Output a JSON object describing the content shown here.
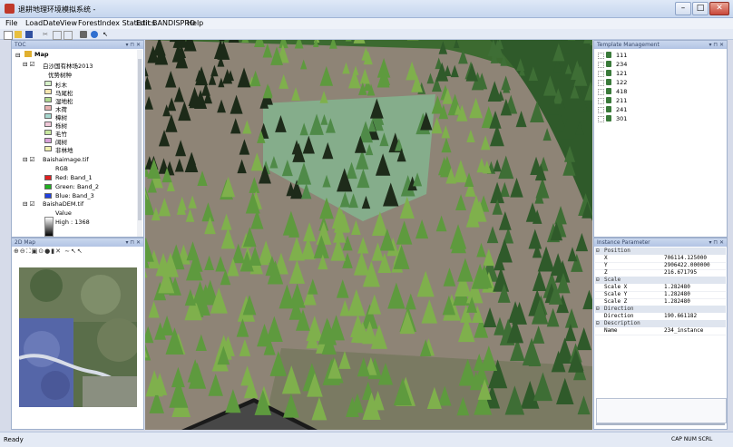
{
  "window": {
    "title": "退耕地理环境模拟系统 -",
    "minimize": "–",
    "maximize": "□",
    "close": "✕"
  },
  "menu": [
    "File",
    "LoadDate",
    "View",
    "Forest",
    "Index Statistics",
    "Edit",
    "BANDISPRO",
    "Help"
  ],
  "toc": {
    "panel_title": "TOC",
    "root_label": "Map",
    "layer1_label": "白沙国有林场2013",
    "layer1_field": "优势树种",
    "classes": [
      {
        "label": "杉木",
        "color": "#d6f0c8"
      },
      {
        "label": "马尾松",
        "color": "#f5e6b0"
      },
      {
        "label": "湿地松",
        "color": "#b0d890"
      },
      {
        "label": "木荷",
        "color": "#e8b0b0"
      },
      {
        "label": "樟树",
        "color": "#a8d8d0"
      },
      {
        "label": "栎树",
        "color": "#f0c8d8"
      },
      {
        "label": "毛竹",
        "color": "#c8e8a0"
      },
      {
        "label": "阔树",
        "color": "#d8a0d8"
      },
      {
        "label": "非林地",
        "color": "#f0f0b0"
      }
    ],
    "layer2_label": "Baishaimage.tif",
    "layer2_field": "RGB",
    "bands": [
      {
        "label": "Red:   Band_1",
        "color": "#e02020"
      },
      {
        "label": "Green: Band_2",
        "color": "#20b020"
      },
      {
        "label": "Blue:  Band_3",
        "color": "#2040e0"
      }
    ],
    "layer3_label": "BaishaDEM.tif",
    "layer3_field": "Value",
    "layer3_high": "High : 1368"
  },
  "map2d": {
    "panel_title": "2D Map"
  },
  "templates": {
    "panel_title": "Template Management",
    "items": [
      "111",
      "234",
      "121",
      "122",
      "418",
      "211",
      "241",
      "301"
    ]
  },
  "params": {
    "panel_title": "Instance Parameter",
    "sections": [
      {
        "name": "Position",
        "rows": [
          [
            "X",
            "706114.125000"
          ],
          [
            "Y",
            "2906422.000000"
          ],
          [
            "Z",
            "216.671795"
          ]
        ]
      },
      {
        "name": "Scale",
        "rows": [
          [
            "Scale X",
            "1.282480"
          ],
          [
            "Scale Y",
            "1.282480"
          ],
          [
            "Scale Z",
            "1.282480"
          ]
        ]
      },
      {
        "name": "Direction",
        "rows": [
          [
            "Direction",
            "190.661182"
          ]
        ]
      },
      {
        "name": "Description",
        "rows": [
          [
            "Name",
            "234_instance"
          ]
        ]
      }
    ]
  },
  "status": {
    "left": "Ready",
    "right": "CAP NUM SCRL"
  }
}
